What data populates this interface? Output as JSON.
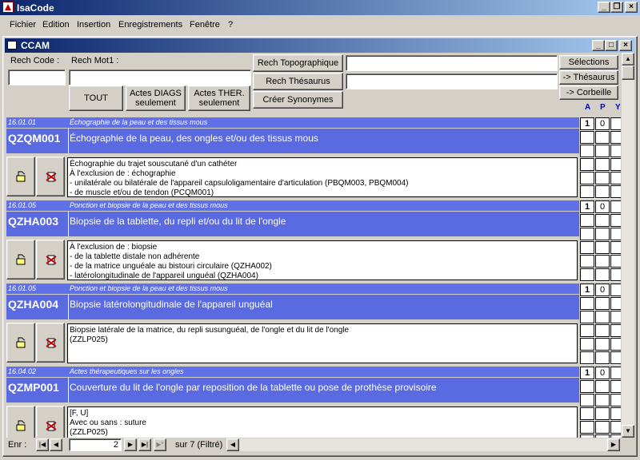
{
  "app": {
    "title": "IsaCode"
  },
  "menu": [
    "Fichier",
    "Edition",
    "Insertion",
    "Enregistrements",
    "Fenêtre",
    "?"
  ],
  "window": {
    "title": "CCAM"
  },
  "search": {
    "code_label": "Rech Code :",
    "word_label": "Rech Mot1 :",
    "code_value": "",
    "word_value": "",
    "topo_value": "",
    "thes_value": ""
  },
  "buttons": {
    "tout": "TOUT",
    "diags_line1": "Actes DIAGS",
    "diags_line2": "seulement",
    "ther_line1": "Actes THER.",
    "ther_line2": "seulement",
    "topo": "Rech Topographique",
    "thesaurus": "Rech Thésaurus",
    "synonymes": "Créer Synonymes",
    "selections": "Sélections",
    "to_thesaurus": "-> Thésaurus",
    "to_corbeille": "-> Corbeille"
  },
  "columns": [
    "A",
    "P",
    "Y"
  ],
  "records": [
    {
      "date": "16.01.01",
      "category": "Échographie de la peau et des tissus mous",
      "code": "QZQM001",
      "label": "Échographie de la peau, des ongles et/ou des tissus mous",
      "note": "Échographie du trajet souscutané d'un cathéter\nÀ l'exclusion de : échographie\n- unilatérale ou bilatérale de l'appareil capsuloligamentaire d'articulation (PBQM003, PBQM004)\n- de muscle et/ou de tendon (PCQM001)",
      "a": "1",
      "p": "0"
    },
    {
      "date": "16.01.05",
      "category": "Ponction et biopsie de la peau et des tissus mous",
      "code": "QZHA003",
      "label": "Biopsie de la tablette, du repli et/ou du lit de l'ongle",
      "note": "À l'exclusion de : biopsie\n- de la tablette distale non adhérente\n- de la matrice unguéale au bistouri circulaire (QZHA002)\n- latérolongitudinale de l'appareil unguéal (QZHA004)",
      "a": "1",
      "p": "0"
    },
    {
      "date": "16.01.05",
      "category": "Ponction et biopsie de la peau et des tissus mous",
      "code": "QZHA004",
      "label": "Biopsie latérolongitudinale de l'appareil unguéal",
      "note": "Biopsie latérale de la matrice, du repli susunguéal, de l'ongle et du lit de l'ongle\n(ZZLP025)",
      "a": "1",
      "p": "0"
    },
    {
      "date": "16.04.02",
      "category": "Actes thérapeutiques sur les ongles",
      "code": "QZMP001",
      "label": "Couverture du lit de l'ongle par reposition de la tablette ou pose de prothèse provisoire",
      "note": "[F, U]\nAvec ou sans : suture\n(ZZLP025)",
      "a": "1",
      "p": "0"
    }
  ],
  "nav": {
    "label": "Enr :",
    "current": "2",
    "total_text": "sur  7 (Filtré)"
  }
}
